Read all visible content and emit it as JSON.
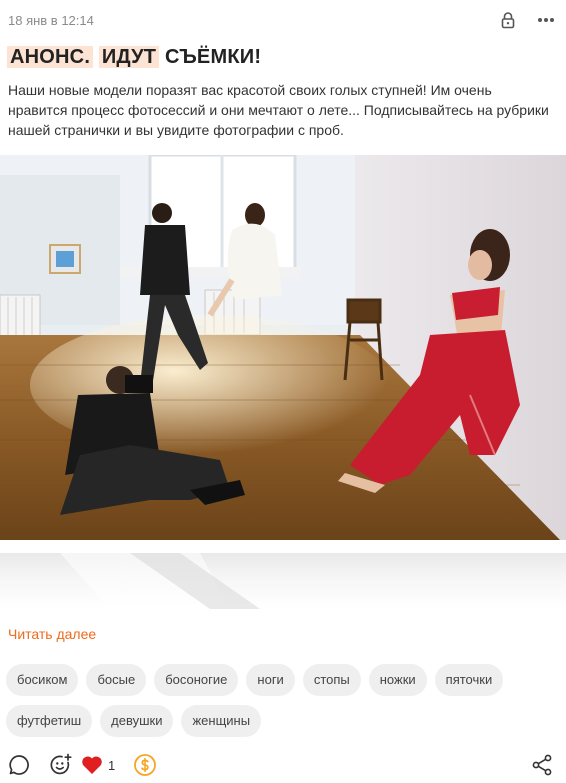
{
  "post": {
    "date": "18 янв в 12:14",
    "title_parts": [
      "АНОНС.",
      "ИДУТ",
      "СЪЁМКИ!"
    ],
    "text": "Наши новые модели поразят вас красотой своих голых ступней! Им очень нравится процесс фотосессий и они мечтают о лете... Подписывайтесь на рубрики нашей странички и вы увидите фотографии с проб.",
    "read_more": "Читать далее"
  },
  "header_icons": [
    "lock-icon",
    "more-icon"
  ],
  "tags": [
    "босиком",
    "босые",
    "босоногие",
    "ноги",
    "стопы",
    "ножки",
    "пяточки",
    "футфетиш",
    "девушки",
    "женщины"
  ],
  "footer": {
    "icons": [
      "comment-icon",
      "add-reaction-icon",
      "heart-icon",
      "coin-icon",
      "share-icon"
    ],
    "like_count": "1"
  },
  "colors": {
    "accent": "#ee6a1c",
    "highlight": "#fde3d3",
    "heart": "#e02020",
    "coin": "#f5a623"
  }
}
